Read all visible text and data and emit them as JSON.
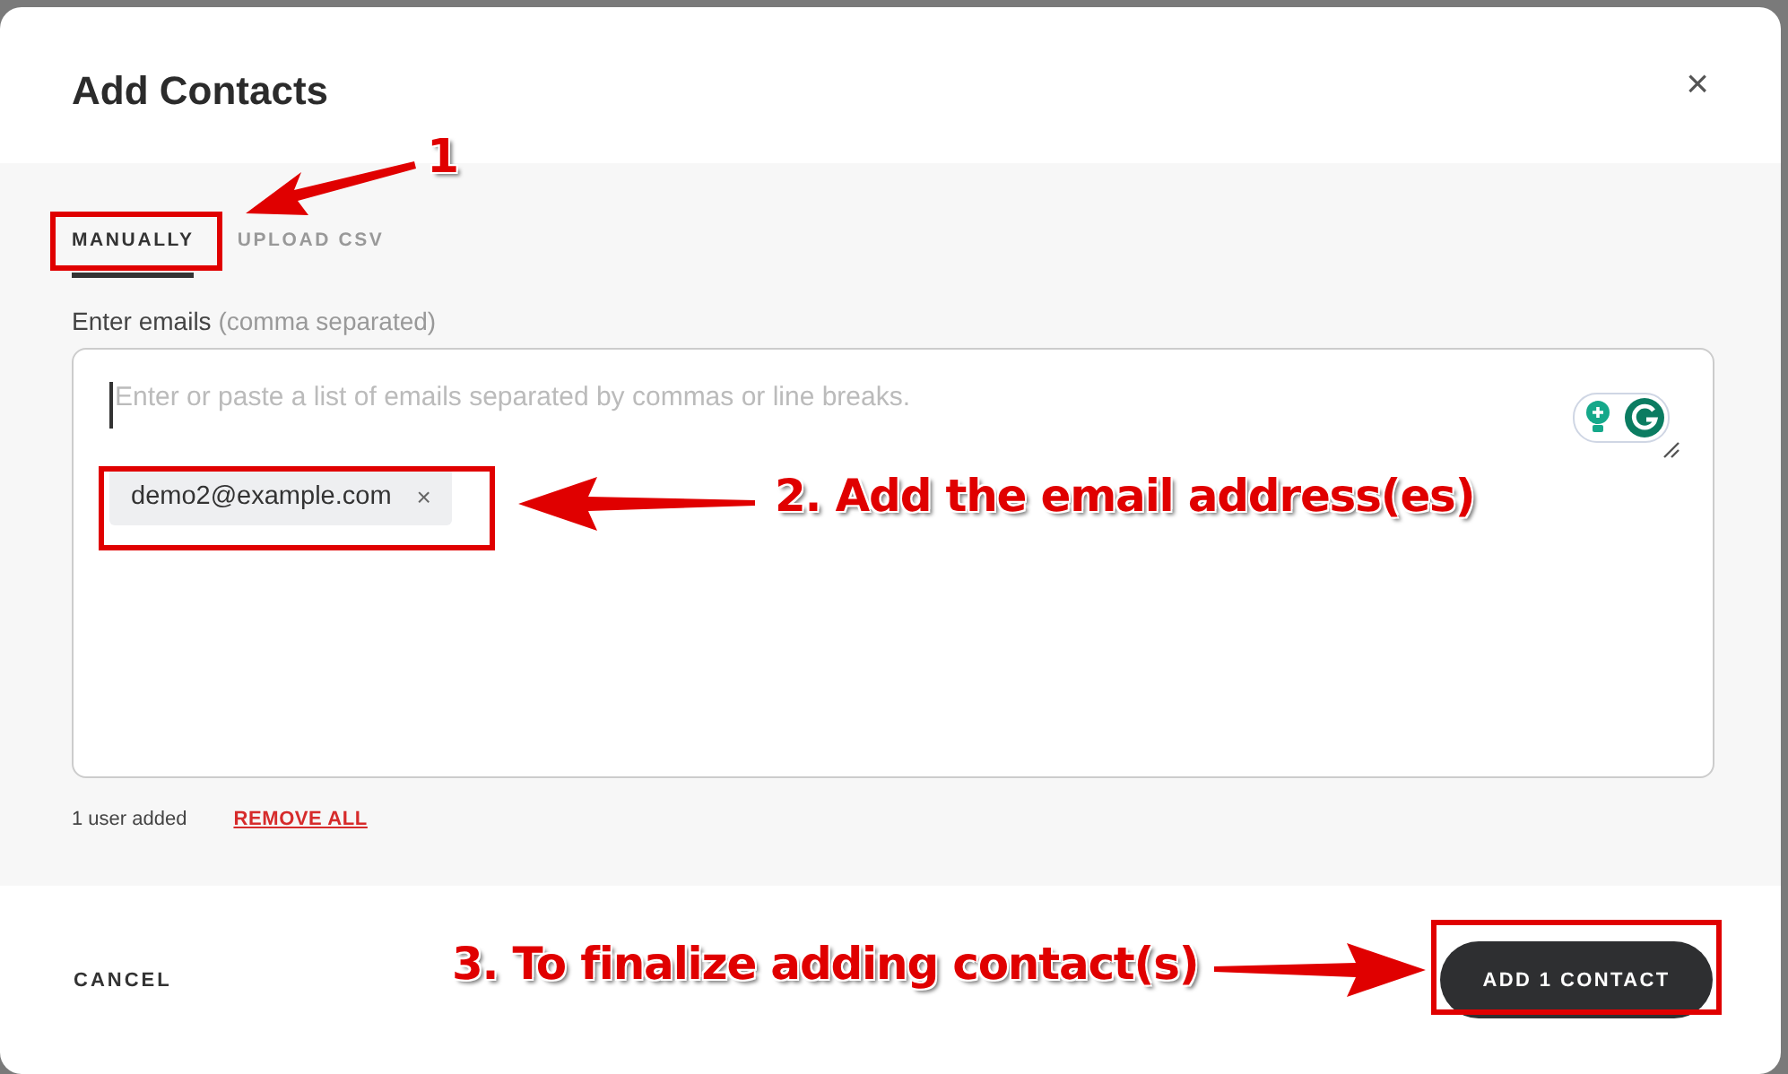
{
  "dialog": {
    "title": "Add Contacts",
    "close": "×"
  },
  "tabs": [
    {
      "label": "MANUALLY",
      "selected": true
    },
    {
      "label": "UPLOAD CSV",
      "selected": false
    }
  ],
  "field": {
    "label": "Enter emails",
    "hint": "(comma separated)",
    "placeholder": "Enter or paste a list of emails separated by commas or line breaks.",
    "chips": [
      {
        "text": "demo2@example.com",
        "remove": "×"
      }
    ]
  },
  "summary": {
    "count": "1 user added",
    "remove_all": "REMOVE ALL"
  },
  "buttons": {
    "cancel": "CANCEL",
    "submit": "ADD 1 CONTACT"
  },
  "annotations": [
    {
      "text": "1"
    },
    {
      "text": "2. Add the email address(es)"
    },
    {
      "text": "3. To finalize adding contact(s)"
    }
  ]
}
